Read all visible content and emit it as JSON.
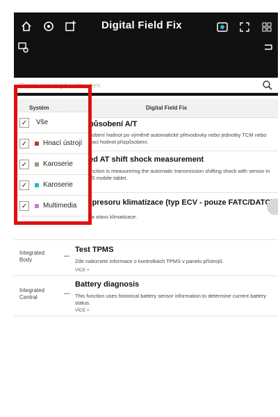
{
  "app": {
    "title": "Digital Field Fix"
  },
  "search": {
    "placeholder": "Please entering function item."
  },
  "columns": {
    "system": "Systém",
    "digital_field_fix": "Digital Field Fix"
  },
  "rows": [
    {
      "system": "",
      "title": "Přizpůsobení A/T",
      "description": "přizpůsobení hodnot po výměně automatické převodovky nebo jednotky TCM nebo inicializaci hodnot přizpůsobení.",
      "more": ""
    },
    {
      "system": "",
      "title": "Speed AT shift shock measurement",
      "description": "This function is measurering the automatic transmission shifting shock with sensor in the GDS mobile tablet.",
      "more": ""
    },
    {
      "system": "",
      "title": "Kompresoru klimatizace (typ ECV - pouze FATC/DATC)",
      "description": "Kontrola stavu klimatizace.",
      "more": ""
    },
    {
      "system": "Integrated Body",
      "title": "Test TPMS",
      "description": "Zde naleznete informace o kontrolkách TPMS v panelu přístrojů.",
      "more": "VÍCE +"
    },
    {
      "system": "Integrated Central",
      "title": "Battery diagnosis",
      "description": "This function uses historical battery sensor information to determine current battery status.",
      "more": "VÍCE +"
    }
  ],
  "dropdown": {
    "items": [
      {
        "label": "Vše",
        "checked": true,
        "color": ""
      },
      {
        "label": "Hnací ústrojí",
        "checked": true,
        "color": "#c0392b"
      },
      {
        "label": "Karoserie",
        "checked": true,
        "color": "#9e9a7c"
      },
      {
        "label": "Karoserie",
        "checked": true,
        "color": "#29b6d9"
      },
      {
        "label": "Multimedia",
        "checked": true,
        "color": "#c77dd1"
      }
    ]
  },
  "ui": {
    "more_dots": "...",
    "check_mark": "✓"
  },
  "colors": {
    "highlight": "#e01010",
    "topbar": "#111111"
  }
}
